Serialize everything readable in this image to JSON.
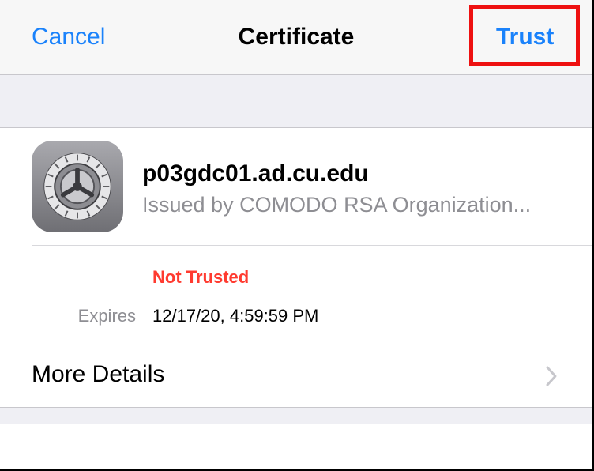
{
  "navbar": {
    "cancel_label": "Cancel",
    "title": "Certificate",
    "trust_label": "Trust"
  },
  "certificate": {
    "name": "p03gdc01.ad.cu.edu",
    "issuer": "Issued by COMODO RSA Organization...",
    "icon": "settings-gear-icon",
    "trust_status": "Not Trusted",
    "expires_label": "Expires",
    "expires_value": "12/17/20, 4:59:59 PM"
  },
  "more_details": {
    "label": "More Details",
    "icon": "chevron-right-icon"
  },
  "colors": {
    "accent": "#1a82fb",
    "danger": "#ff3b30",
    "highlight": "#ee1111",
    "secondary_text": "#8e8e93",
    "group_background": "#efeff4"
  }
}
